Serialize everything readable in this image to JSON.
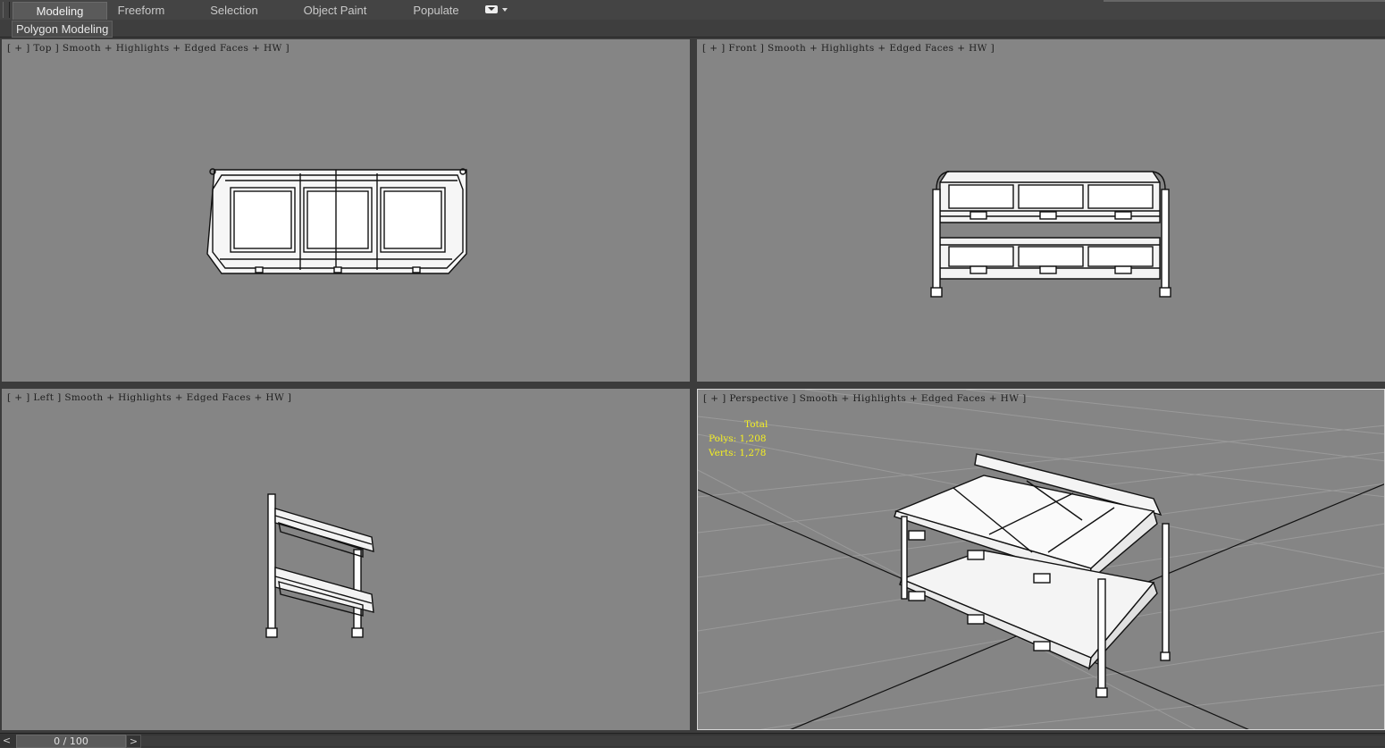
{
  "ribbon": {
    "tabs": [
      {
        "label": "Modeling",
        "active": true
      },
      {
        "label": "Freeform",
        "active": false
      },
      {
        "label": "Selection",
        "active": false
      },
      {
        "label": "Object Paint",
        "active": false
      },
      {
        "label": "Populate",
        "active": false
      }
    ],
    "dropdown_icon": "ribbon-options-icon"
  },
  "subbar": {
    "label": "Polygon Modeling"
  },
  "viewports": [
    {
      "name": "Top",
      "parts": [
        "[ + ]",
        "Top",
        "]",
        "Smooth + Highlights + Edged Faces + HW ]"
      ]
    },
    {
      "name": "Front",
      "parts": [
        "[ + ]",
        "Front",
        "]",
        "Smooth + Highlights + Edged Faces + HW ]"
      ]
    },
    {
      "name": "Left",
      "parts": [
        "[ + ]",
        "Left",
        "]",
        "Smooth + Highlights + Edged Faces + HW ]"
      ]
    },
    {
      "name": "Perspective",
      "parts": [
        "[ + ]",
        "Perspective",
        "]",
        "Smooth + Highlights + Edged Faces + HW ]"
      ]
    }
  ],
  "stats": {
    "title": "Total",
    "polys": "Polys: 1,208",
    "verts": "Verts: 1,278"
  },
  "timeline": {
    "prev": "<",
    "position": "0 / 100",
    "next": ">"
  },
  "colors": {
    "viewport_bg": "#858585",
    "wire": "#ffffff",
    "stats_text": "#f3ee23",
    "grid": "#9a9a9a"
  }
}
